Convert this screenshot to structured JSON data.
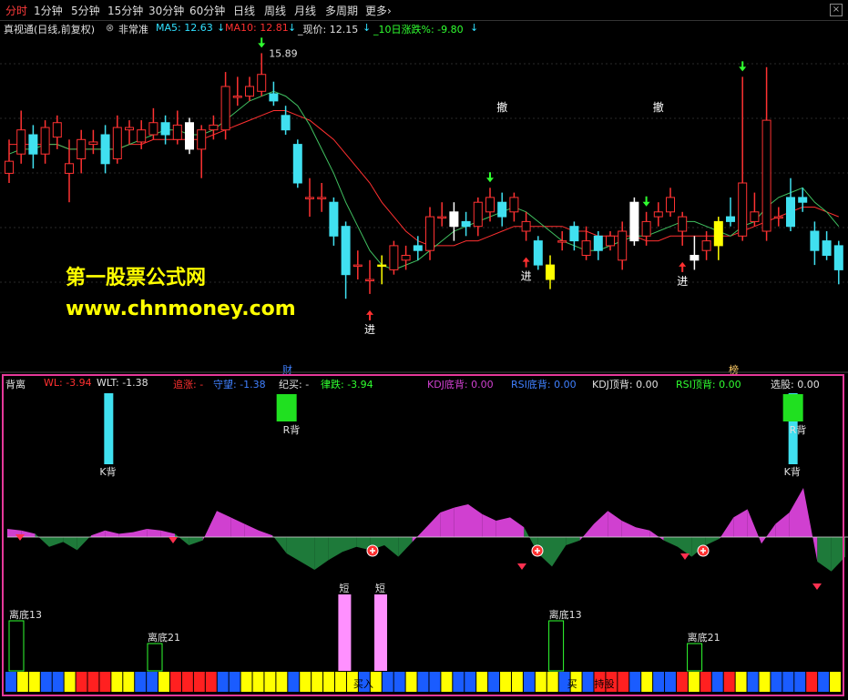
{
  "toolbar": {
    "items": [
      "分时",
      "1分钟",
      "5分钟",
      "15分钟",
      "30分钟",
      "60分钟",
      "日线",
      "周线",
      "月线",
      "多周期",
      "更多"
    ],
    "active_index": 0,
    "more_suffix": "›"
  },
  "colors": {
    "up": "#ff3232",
    "down": "#40e0f0",
    "ma5": "#e0e0e0",
    "ma10": "#ff3030",
    "yellow": "#ffff00",
    "green_label": "#30ff30",
    "magenta": "#d040d0",
    "dark_green": "#1e7a3a",
    "frame": "#e6399a"
  },
  "upper_info": {
    "title": "真视通(日线,前复权)",
    "mode": "非常准",
    "ma5": "MA5: 12.63",
    "ma10": "MA10: 12.81",
    "price": "_现价: 12.15",
    "chg10": "_10日涨跌%: -9.80"
  },
  "lower_info": {
    "name": "背离",
    "wl": "WL: -3.94",
    "wlt": "WLT: -1.38",
    "zhang": "追涨: -",
    "shouwang": "守望: -1.38",
    "jimai": "纪买: -",
    "lvdie": "律跌: -3.94",
    "kdj_di": "KDJ底背: 0.00",
    "rsi_di": "RSI底背: 0.00",
    "kdj_ding": "KDJ顶背: 0.00",
    "rsi_ding": "RSI顶背: 0.00",
    "xuangu": "选股: 0.00"
  },
  "watermark": {
    "line1": "第一股票公式网",
    "line2": "www.chnmoney.com"
  },
  "chart_data": {
    "type": "candlestick",
    "price_ylim": [
      10.2,
      16.2
    ],
    "high_label": "15.89",
    "candles": [
      [
        13.4,
        13.65,
        14.1,
        13.2
      ],
      [
        13.8,
        14.3,
        14.7,
        13.6
      ],
      [
        14.2,
        13.8,
        14.4,
        13.5
      ],
      [
        13.8,
        14.35,
        14.5,
        13.6
      ],
      [
        14.15,
        14.45,
        14.6,
        13.9
      ],
      [
        13.4,
        13.6,
        14.1,
        12.8
      ],
      [
        13.7,
        14.1,
        14.3,
        13.4
      ],
      [
        14.0,
        14.05,
        14.3,
        13.8
      ],
      [
        14.2,
        13.6,
        14.4,
        13.4
      ],
      [
        13.7,
        14.35,
        14.6,
        13.6
      ],
      [
        14.3,
        14.35,
        14.5,
        14.0
      ],
      [
        14.05,
        14.3,
        14.5,
        13.9
      ],
      [
        14.2,
        14.45,
        14.75,
        14.1
      ],
      [
        14.45,
        14.2,
        14.6,
        14.0
      ],
      [
        14.1,
        14.4,
        14.7,
        14.0
      ],
      [
        14.45,
        13.9,
        14.55,
        13.8
      ],
      [
        13.9,
        14.3,
        14.4,
        13.3
      ],
      [
        14.3,
        14.4,
        14.6,
        14.1
      ],
      [
        14.3,
        15.2,
        15.5,
        14.1
      ],
      [
        15.0,
        15.0,
        15.4,
        14.8
      ],
      [
        15.0,
        15.2,
        15.4,
        14.9
      ],
      [
        15.1,
        15.45,
        15.89,
        15.0
      ],
      [
        15.05,
        14.9,
        15.3,
        14.8
      ],
      [
        14.6,
        14.3,
        14.8,
        14.2
      ],
      [
        14.0,
        13.2,
        14.1,
        13.1
      ],
      [
        12.9,
        12.9,
        13.3,
        12.5
      ],
      [
        12.9,
        12.9,
        13.2,
        12.6
      ],
      [
        12.8,
        12.1,
        12.9,
        11.9
      ],
      [
        12.3,
        11.3,
        12.4,
        10.8
      ],
      [
        11.5,
        11.5,
        11.8,
        11.2
      ],
      [
        11.2,
        11.2,
        11.6,
        10.9
      ],
      [
        11.5,
        11.5,
        11.7,
        11.1
      ],
      [
        11.4,
        11.9,
        12.0,
        11.3
      ],
      [
        11.6,
        11.7,
        11.9,
        11.4
      ],
      [
        11.9,
        11.8,
        12.1,
        11.6
      ],
      [
        11.8,
        12.5,
        12.7,
        11.6
      ],
      [
        12.5,
        12.5,
        12.8,
        12.3
      ],
      [
        12.3,
        12.6,
        12.8,
        12.0
      ],
      [
        12.4,
        12.3,
        12.6,
        12.1
      ],
      [
        12.3,
        12.8,
        12.9,
        12.1
      ],
      [
        12.6,
        12.9,
        13.1,
        12.4
      ],
      [
        12.8,
        12.5,
        13.0,
        12.3
      ],
      [
        12.6,
        12.9,
        13.0,
        12.4
      ],
      [
        12.2,
        12.4,
        12.6,
        12.0
      ],
      [
        12.0,
        11.5,
        12.1,
        11.4
      ],
      [
        11.5,
        11.2,
        11.7,
        11.0
      ],
      [
        12.0,
        12.0,
        12.2,
        11.8
      ],
      [
        12.3,
        12.0,
        12.4,
        11.8
      ],
      [
        11.7,
        12.0,
        12.3,
        11.6
      ],
      [
        12.1,
        11.8,
        12.2,
        11.6
      ],
      [
        11.9,
        12.1,
        12.2,
        11.8
      ],
      [
        11.6,
        12.2,
        12.4,
        11.4
      ],
      [
        12.8,
        12.0,
        12.9,
        11.9
      ],
      [
        12.1,
        12.4,
        12.6,
        11.9
      ],
      [
        12.5,
        12.6,
        12.8,
        12.3
      ],
      [
        12.6,
        12.9,
        13.1,
        12.5
      ],
      [
        12.2,
        12.5,
        12.6,
        11.9
      ],
      [
        11.7,
        11.6,
        12.1,
        11.4
      ],
      [
        11.8,
        12.0,
        12.2,
        11.6
      ],
      [
        11.9,
        12.4,
        12.5,
        11.6
      ],
      [
        12.5,
        12.4,
        12.9,
        12.3
      ],
      [
        12.1,
        13.2,
        15.4,
        12.0
      ],
      [
        12.4,
        12.6,
        13.0,
        12.3
      ],
      [
        12.2,
        14.5,
        15.6,
        12.0
      ],
      [
        12.5,
        12.5,
        12.7,
        12.3
      ],
      [
        12.9,
        12.3,
        13.3,
        12.2
      ],
      [
        12.9,
        12.8,
        13.1,
        12.6
      ],
      [
        12.2,
        11.8,
        12.4,
        11.5
      ],
      [
        12.0,
        11.7,
        12.2,
        11.6
      ],
      [
        11.9,
        11.4,
        12.0,
        11.1
      ]
    ],
    "yellow_candles": [
      31,
      45,
      59
    ],
    "white_candles": [
      15,
      37,
      52,
      57
    ],
    "ma5": [
      13.8,
      13.9,
      13.9,
      14.0,
      14.0,
      13.9,
      13.9,
      13.9,
      13.9,
      13.9,
      14.0,
      14.1,
      14.2,
      14.3,
      14.3,
      14.2,
      14.2,
      14.3,
      14.5,
      14.7,
      14.9,
      15.0,
      15.1,
      15.0,
      14.8,
      14.4,
      13.9,
      13.4,
      12.8,
      12.3,
      11.8,
      11.5,
      11.4,
      11.5,
      11.6,
      11.8,
      12.0,
      12.2,
      12.3,
      12.4,
      12.5,
      12.6,
      12.7,
      12.6,
      12.4,
      12.2,
      12.0,
      11.9,
      11.8,
      11.8,
      11.9,
      12.0,
      12.1,
      12.1,
      12.2,
      12.3,
      12.4,
      12.4,
      12.3,
      12.2,
      12.1,
      12.3,
      12.4,
      12.7,
      12.9,
      13.0,
      13.1,
      12.8,
      12.6,
      12.3
    ],
    "ma10": [
      14.0,
      14.0,
      14.0,
      14.0,
      14.0,
      13.9,
      13.9,
      13.9,
      13.9,
      13.9,
      14.0,
      14.0,
      14.1,
      14.1,
      14.1,
      14.1,
      14.1,
      14.2,
      14.3,
      14.4,
      14.5,
      14.6,
      14.7,
      14.7,
      14.6,
      14.5,
      14.3,
      14.1,
      13.8,
      13.5,
      13.2,
      12.8,
      12.5,
      12.2,
      12.0,
      11.9,
      11.9,
      11.9,
      12.0,
      12.0,
      12.1,
      12.2,
      12.3,
      12.3,
      12.3,
      12.3,
      12.3,
      12.2,
      12.2,
      12.1,
      12.1,
      12.1,
      12.1,
      12.0,
      12.0,
      12.1,
      12.1,
      12.1,
      12.1,
      12.1,
      12.1,
      12.2,
      12.3,
      12.4,
      12.5,
      12.6,
      12.7,
      12.7,
      12.6,
      12.5
    ],
    "signals": [
      {
        "type": "sell_arrow",
        "index": 21
      },
      {
        "type": "sell_arrow",
        "index": 40
      },
      {
        "type": "sell_arrow",
        "index": 53
      },
      {
        "type": "sell_arrow",
        "index": 61
      },
      {
        "type": "buy_arrow",
        "index": 30,
        "label": "进"
      },
      {
        "type": "buy_arrow",
        "index": 43,
        "label": "进"
      },
      {
        "type": "buy_arrow",
        "index": 56,
        "label": "进"
      },
      {
        "type": "text",
        "index": 41,
        "label": "撤"
      },
      {
        "type": "text",
        "index": 54,
        "label": "撤"
      }
    ],
    "divergence_hist": [
      0.5,
      0.4,
      0.2,
      -0.6,
      -0.3,
      -0.8,
      0.1,
      0.4,
      0.2,
      0.3,
      0.5,
      0.4,
      0.2,
      -0.5,
      -0.2,
      1.6,
      1.2,
      0.8,
      0.4,
      0.1,
      -1.0,
      -1.5,
      -2.0,
      -1.4,
      -0.9,
      -0.6,
      -0.8,
      -0.5,
      -1.2,
      -0.3,
      0.6,
      1.5,
      1.8,
      2.0,
      1.4,
      1.0,
      1.2,
      0.6,
      -1.0,
      -1.8,
      -0.5,
      -0.2,
      0.8,
      1.6,
      1.0,
      0.6,
      0.4,
      -0.2,
      -0.6,
      -1.2,
      -0.5,
      -0.1,
      1.2,
      1.7,
      -0.4,
      0.8,
      1.5,
      3.0,
      -1.5,
      -2.1,
      -1.2
    ],
    "kbei_bars": [
      {
        "index": 4,
        "label": "K背"
      },
      {
        "index": 53,
        "label": "K背"
      }
    ],
    "rbei_bars": [
      {
        "index": 20,
        "label": "R背"
      },
      {
        "index": 53,
        "label": "R背"
      }
    ],
    "short_bars": [
      {
        "index": 27,
        "label": "短"
      },
      {
        "index": 30,
        "label": "短"
      }
    ],
    "libottom_bars": [
      {
        "index": 0,
        "label": "离底13"
      },
      {
        "index": 10,
        "label": "离底21"
      },
      {
        "index": 43,
        "label": "离底13"
      },
      {
        "index": 53,
        "label": "离底21"
      }
    ],
    "bottom_labels": [
      {
        "index": 30,
        "label": "买入"
      },
      {
        "index": 48,
        "label": "买"
      },
      {
        "index": 50,
        "label": "持股"
      }
    ],
    "bottom_strip": [
      "b",
      "y",
      "y",
      "b",
      "b",
      "y",
      "r",
      "r",
      "r",
      "y",
      "y",
      "b",
      "b",
      "y",
      "r",
      "r",
      "r",
      "r",
      "b",
      "b",
      "y",
      "y",
      "y",
      "y",
      "b",
      "y",
      "y",
      "y",
      "y",
      "y",
      "b",
      "y",
      "b",
      "b",
      "y",
      "b",
      "b",
      "y",
      "b",
      "b",
      "y",
      "b",
      "y",
      "y",
      "b",
      "y",
      "y",
      "b",
      "y",
      "b",
      "r",
      "r",
      "r",
      "b",
      "y",
      "b",
      "b",
      "r",
      "y",
      "r",
      "b",
      "r",
      "y",
      "b",
      "y",
      "b",
      "b",
      "b",
      "r",
      "b",
      "y"
    ]
  },
  "axis_labels": {
    "cai": "财",
    "bang": "榜"
  }
}
